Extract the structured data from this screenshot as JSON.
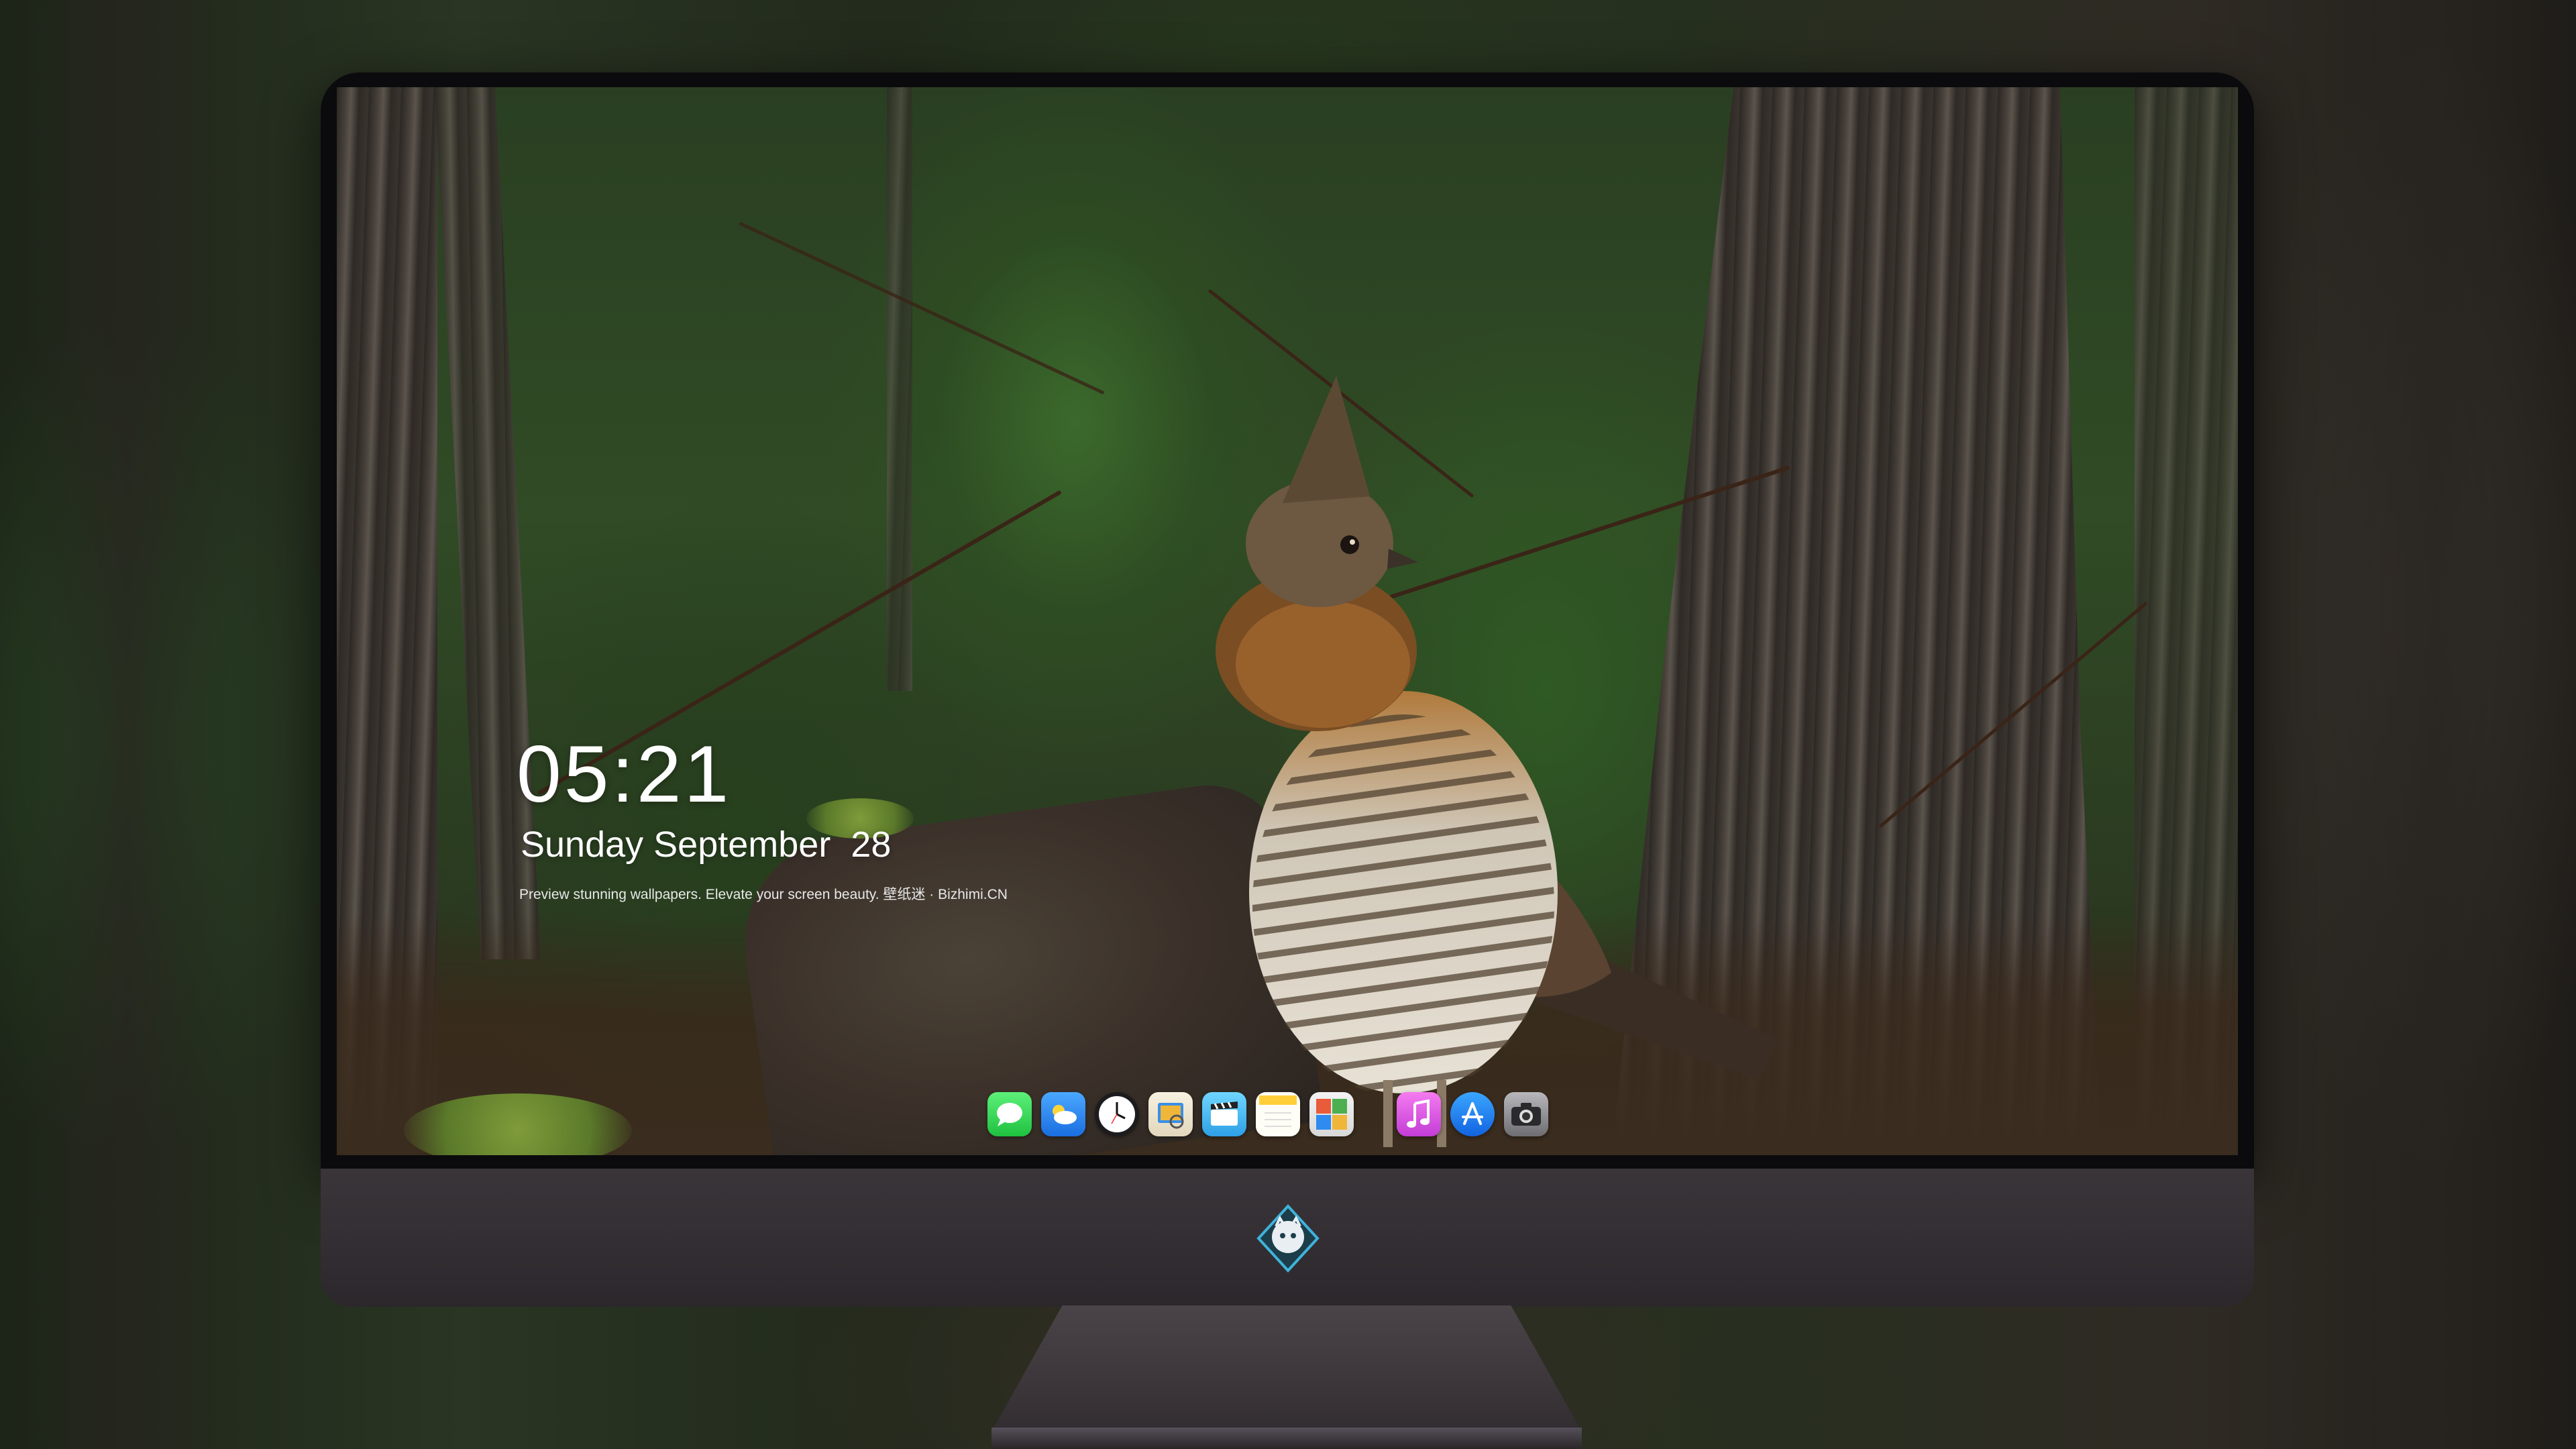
{
  "lock_screen": {
    "time": "05:21",
    "date": "Sunday September  28",
    "tagline": "Preview stunning wallpapers. Elevate your screen beauty. 壁纸迷 · Bizhimi.CN"
  },
  "dock": {
    "apps": [
      {
        "name": "messages-icon",
        "color": "#2fd158"
      },
      {
        "name": "weather-icon",
        "color": "#2f8bf0"
      },
      {
        "name": "clock-icon",
        "color": "#ffffff"
      },
      {
        "name": "preview-icon",
        "color": "#f0b63a"
      },
      {
        "name": "clips-icon",
        "color": "#3fb8f0"
      },
      {
        "name": "notes-icon",
        "color": "#ffd54a"
      },
      {
        "name": "photo-booth-icon",
        "color": "#e85c3a"
      },
      {
        "name": "music-icon",
        "color": "#e14ad8"
      },
      {
        "name": "app-store-icon",
        "color": "#1e7cf0"
      },
      {
        "name": "camera-icon",
        "color": "#8a8a8e"
      }
    ]
  },
  "colors": {
    "bezel": "#0b0b0d",
    "chin": "#332e33",
    "stand": "#3b3539"
  }
}
